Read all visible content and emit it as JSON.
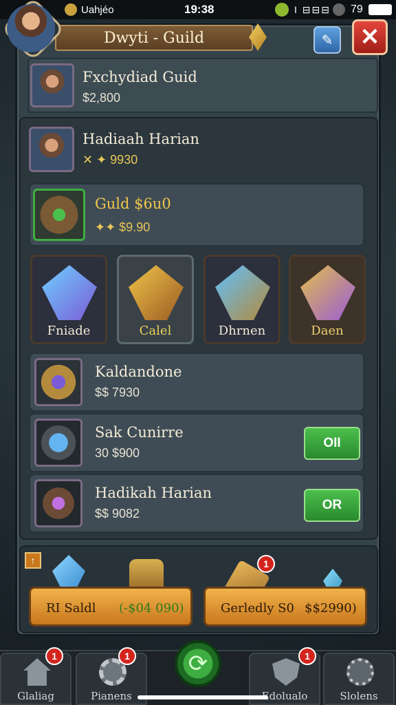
{
  "status_bar": {
    "carrier": "Uahjéo",
    "time": "19:38",
    "signal": "I ⊟⊟⊟",
    "battery": "79"
  },
  "dialog": {
    "title": "Dwyti - Guild",
    "info_icon": "info-icon",
    "close_icon": "close-x-icon",
    "close_label": "✕"
  },
  "guild_header": {
    "name": "Fxchydiad Guid",
    "amount": "$2,800"
  },
  "rows": [
    {
      "title": "Hadiaah Harian",
      "value": "✕ ✦ 9930"
    },
    {
      "title": "Guld $6u0",
      "value": "✦✦ $9.90"
    }
  ],
  "items": [
    {
      "label": "Fniade",
      "color": "#7a5bd6"
    },
    {
      "label": "Calel",
      "color": "#c98a34"
    },
    {
      "label": "Dhrnen",
      "color": "#c9a23c"
    },
    {
      "label": "Daen",
      "color": "#9a5bd6"
    }
  ],
  "list": [
    {
      "title": "Kaldandone",
      "value": "$$ 7930",
      "button": ""
    },
    {
      "title": "Sak Cunirre",
      "value": "30 $900",
      "button": "OII"
    },
    {
      "title": "Hadikah Harian",
      "value": "$$ 9082",
      "button": "OR"
    }
  ],
  "rewards": [
    {
      "left_text": "RI Saldl",
      "right_text": "(-$04 090)"
    },
    {
      "left_text": "Gerledly S0",
      "right_text": "$$2990)"
    }
  ],
  "nav": [
    {
      "label": "Glaliag",
      "icon": "home-icon",
      "badge": "1"
    },
    {
      "label": "Pianens",
      "icon": "gear-icon",
      "badge": "1"
    },
    {
      "label": "Edolualo",
      "icon": "shield-icon",
      "badge": "1"
    },
    {
      "label": "Slolens",
      "icon": "cog-icon",
      "badge": ""
    }
  ],
  "reward_badge": "1",
  "plus_badge": "↑",
  "center_nav_glyph": "⟳"
}
